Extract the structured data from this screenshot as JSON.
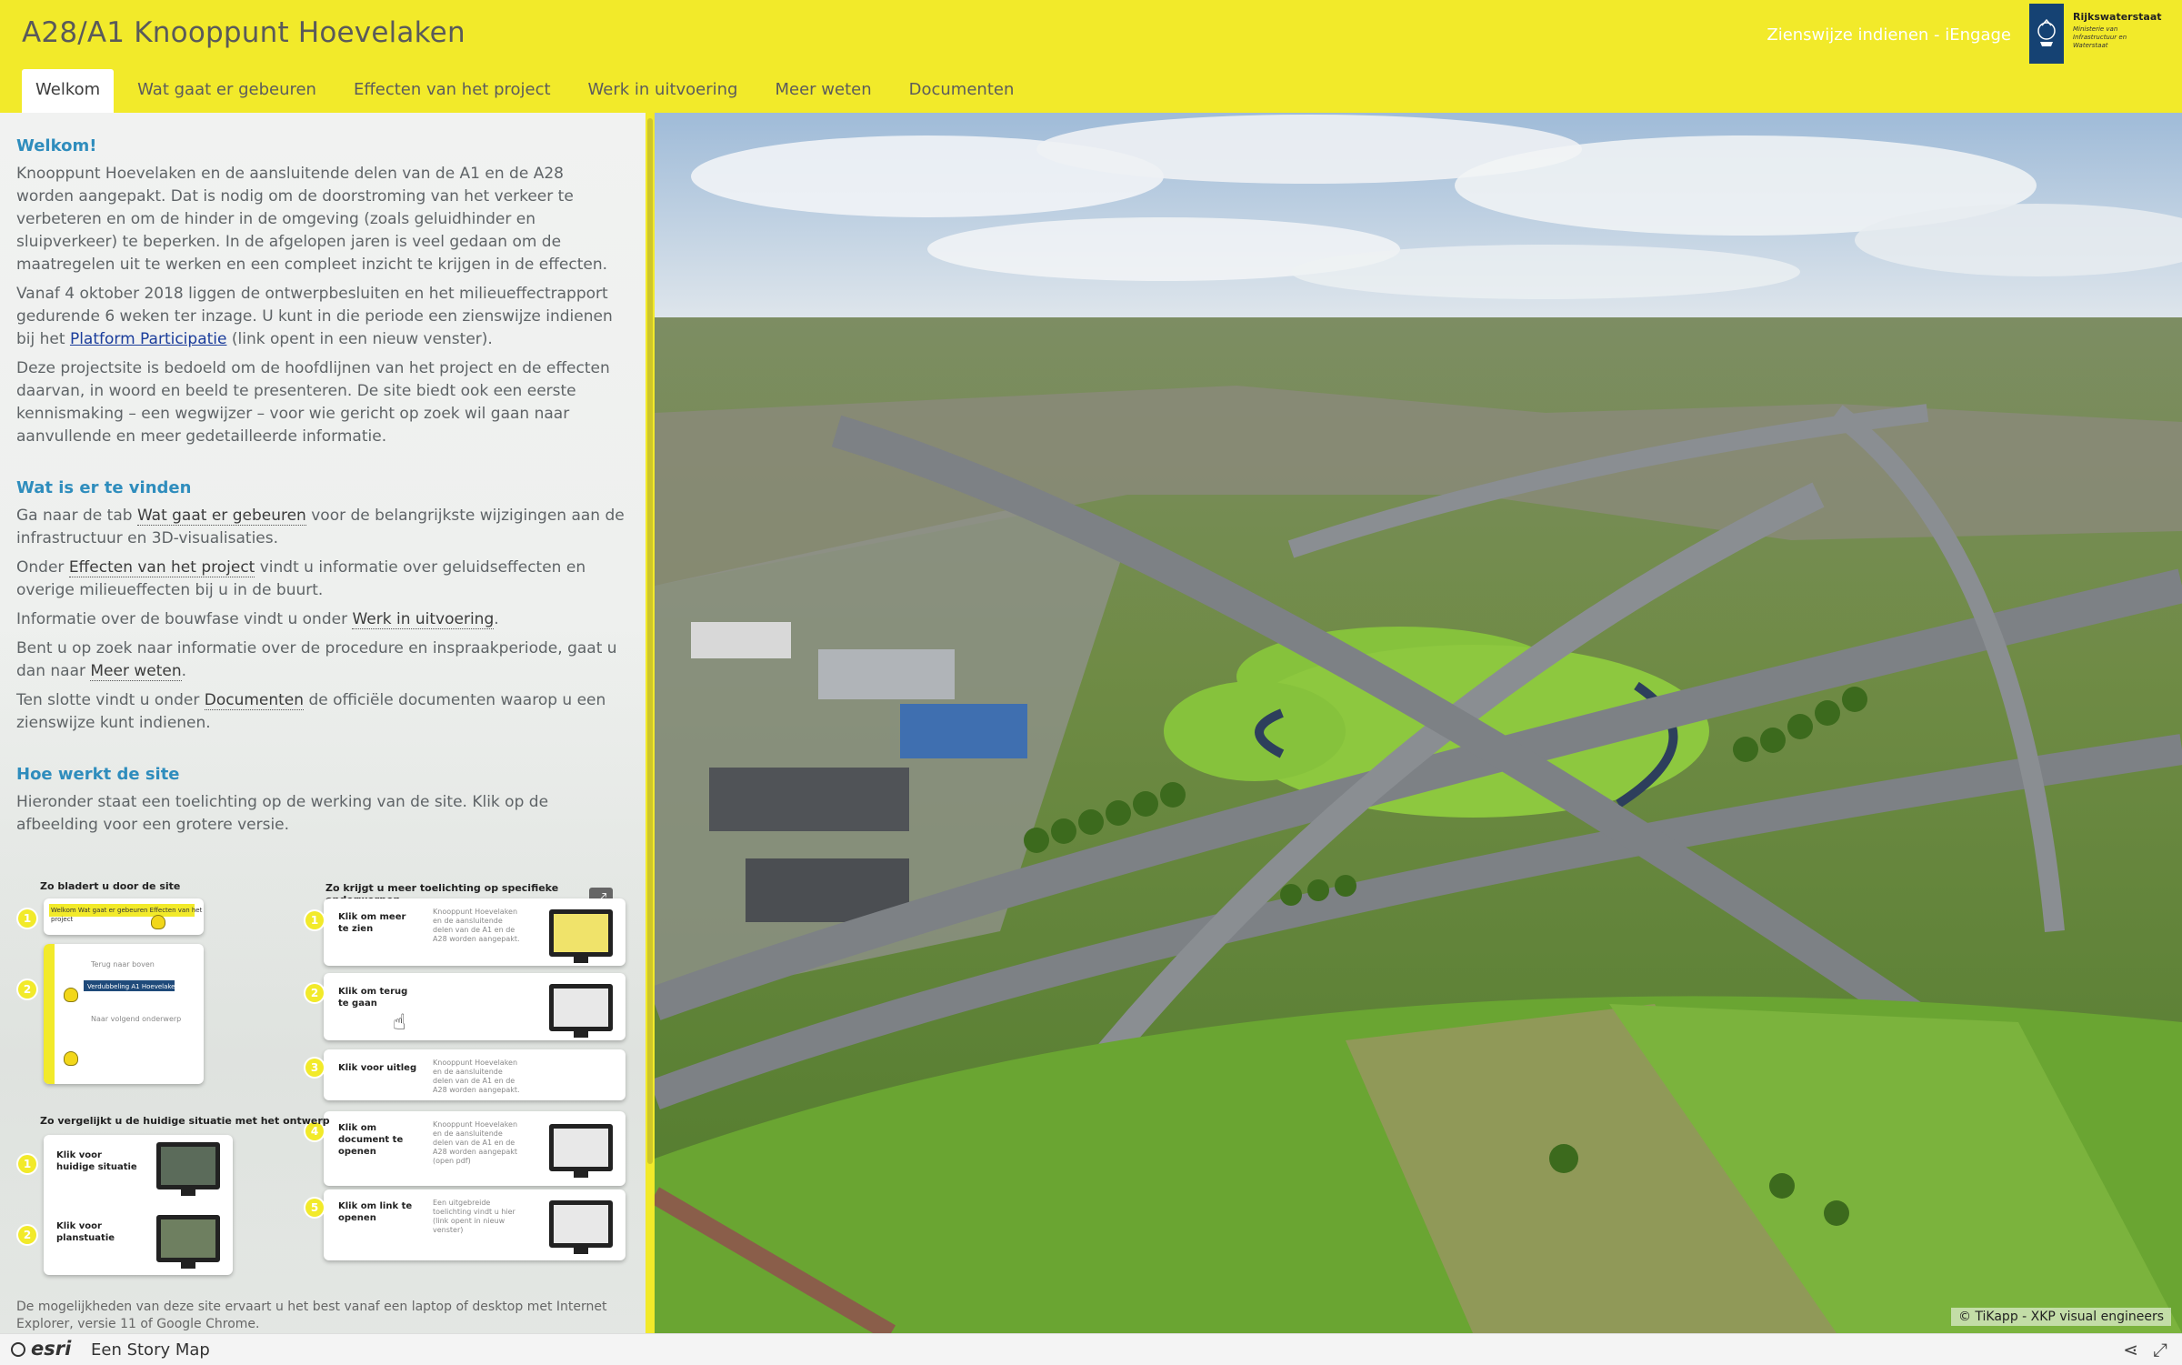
{
  "header": {
    "title": "A28/A1 Knooppunt Hoevelaken",
    "tabs": [
      {
        "label": "Welkom",
        "active": true
      },
      {
        "label": "Wat gaat er gebeuren",
        "active": false
      },
      {
        "label": "Effecten van het project",
        "active": false
      },
      {
        "label": "Werk in uitvoering",
        "active": false
      },
      {
        "label": "Meer weten",
        "active": false
      },
      {
        "label": "Documenten",
        "active": false
      }
    ],
    "submit_link": "Zienswijze indienen - iEngage",
    "logo": {
      "name": "Rijkswaterstaat",
      "subtitle": "Ministerie van Infrastructuur en Waterstaat"
    }
  },
  "panel": {
    "welcome_heading": "Welkom!",
    "p1": "Knooppunt Hoevelaken en de aansluitende delen van de A1 en de A28 worden aangepakt. Dat is nodig om de doorstroming van het verkeer te verbeteren en om de hinder in de omgeving (zoals geluidhinder en sluipverkeer) te beperken. In de afgelopen jaren is veel gedaan om de maatregelen uit te werken en een compleet inzicht te krijgen in de effecten.",
    "p2_pre": "Vanaf 4 oktober 2018 liggen de ontwerpbesluiten en het milieueffectrapport gedurende 6 weken ter inzage. U kunt in die periode een zienswijze indienen bij het ",
    "p2_link": "Platform Participatie",
    "p2_post": " (link opent in een nieuw venster).",
    "p3": "Deze projectsite is bedoeld om de hoofdlijnen van het project en de effecten daarvan, in woord en beeld te presenteren. De site biedt ook een eerste kennismaking – een wegwijzer – voor wie gericht op zoek wil gaan naar aanvullende en meer gedetailleerde informatie.",
    "find_heading": "Wat is er te vinden",
    "f1_pre": "Ga naar de tab ",
    "f1_link": "Wat gaat er gebeuren",
    "f1_post": " voor de belangrijkste wijzigingen aan de infrastructuur en 3D-visualisaties.",
    "f2_pre": "Onder ",
    "f2_link": "Effecten van het project",
    "f2_post": " vindt u informatie over geluidseffecten en overige milieueffecten bij u in de buurt.",
    "f3_pre": "Informatie over de bouwfase vindt u onder ",
    "f3_link": "Werk in uitvoering",
    "f3_post": ".",
    "f4_pre": "Bent u op zoek naar informatie over de procedure en inspraakperiode, gaat u dan naar ",
    "f4_link": "Meer weten",
    "f4_post": ".",
    "f5_pre": "Ten slotte vindt u onder ",
    "f5_link": "Documenten",
    "f5_post": " de officiële documenten waarop u een zienswijze kunt indienen.",
    "how_heading": "Hoe werkt de site",
    "how_p": "Hieronder staat een toelichting op de werking van de site. Klik op de afbeelding voor een grotere versie.",
    "note": "De mogelijkheden van deze site ervaart u het best vanaf een laptop of desktop met Internet Explorer, versie 11 of Google Chrome."
  },
  "infographic": {
    "title_browse": "Zo bladert u door de site",
    "title_more": "Zo krijgt u meer toelichting op specifieke onderwerpen",
    "title_compare": "Zo vergelijkt u de huidige situatie met het ontwerp",
    "more_steps": [
      {
        "num": "1",
        "label": "Klik om meer te zien"
      },
      {
        "num": "2",
        "label": "Klik om terug te gaan"
      },
      {
        "num": "3",
        "label": "Klik voor uitleg"
      },
      {
        "num": "4",
        "label": "Klik om document te openen"
      },
      {
        "num": "5",
        "label": "Klik om link te openen"
      }
    ],
    "compare_steps": [
      {
        "num": "1",
        "label": "Klik voor huidige situatie"
      },
      {
        "num": "2",
        "label": "Klik voor planstuatie"
      }
    ],
    "browse_steps": [
      {
        "num": "1"
      },
      {
        "num": "2"
      }
    ],
    "mini_browse_1": "Welkom   Wat gaat er gebeuren   Effecten van het project",
    "mini_browse_2a": "Terug naar boven",
    "mini_browse_2b": "Verdubbeling A1 Hoevelaken West",
    "mini_browse_2c": "Naar volgend onderwerp",
    "mini_more_1": "Knooppunt Hoevelaken en de aansluitende delen van de A1 en de A28 worden aangepakt.",
    "mini_more_4": "Knooppunt Hoevelaken en de aansluitende delen van de A1 en de A28 worden aangepakt (open pdf)",
    "mini_more_5": "Een uitgebreide toelichting vindt u hier (link opent in nieuw venster)"
  },
  "image": {
    "credit": "© TiKapp - XKP visual engineers",
    "sky": "#b9cfe4",
    "grass": "#79b33a",
    "road": "#7d8185"
  },
  "footer": {
    "brand": "esri",
    "text": "Een Story Map"
  },
  "colors": {
    "header_yellow": "#f2ea2a",
    "heading_blue": "#2f8dbd",
    "link_blue": "#1a3c9b"
  }
}
